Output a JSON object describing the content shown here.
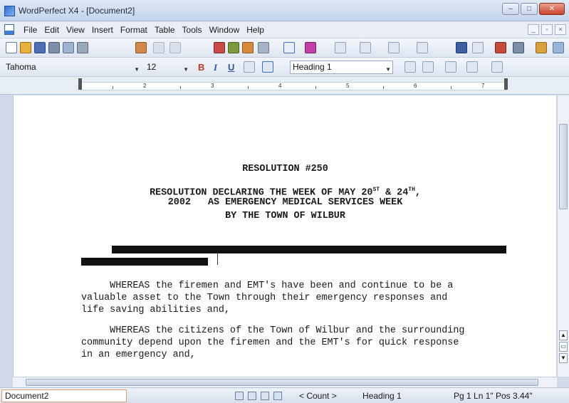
{
  "window": {
    "title": "WordPerfect X4 - [Document2]",
    "controls": [
      "–",
      "□",
      "✕"
    ]
  },
  "menubar": {
    "items": [
      "File",
      "Edit",
      "View",
      "Insert",
      "Format",
      "Table",
      "Tools",
      "Window",
      "Help"
    ]
  },
  "property_bar": {
    "font_name": "Tahoma",
    "font_size": "12",
    "bold": "B",
    "italic": "I",
    "underline": "U",
    "style": "Heading 1"
  },
  "ruler": {
    "numbers": [
      "2",
      "3",
      "4",
      "5",
      "6",
      "7"
    ]
  },
  "document": {
    "title": "RESOLUTION #250",
    "line1_a": "RESOLUTION DECLARING THE WEEK OF MAY 20",
    "line1_sup1": "ST",
    "line1_b": " & 24",
    "line1_sup2": "TH",
    "line1_c": ",",
    "line2": "2002   AS EMERGENCY MEDICAL SERVICES WEEK",
    "line3": "BY THE TOWN OF WILBUR",
    "para1": "     WHEREAS the firemen and EMT's have been and continue to be a\nvaluable asset to the Town through their emergency responses and\nlife saving abilities and,",
    "para2": "     WHEREAS the citizens of the Town of Wilbur and the surrounding\ncommunity depend upon the firemen and the EMT's for quick response\nin an emergency and,"
  },
  "status": {
    "document": "Document2",
    "count": "< Count >",
    "style": "Heading 1",
    "position": "Pg 1 Ln 1\" Pos 3.44\""
  }
}
